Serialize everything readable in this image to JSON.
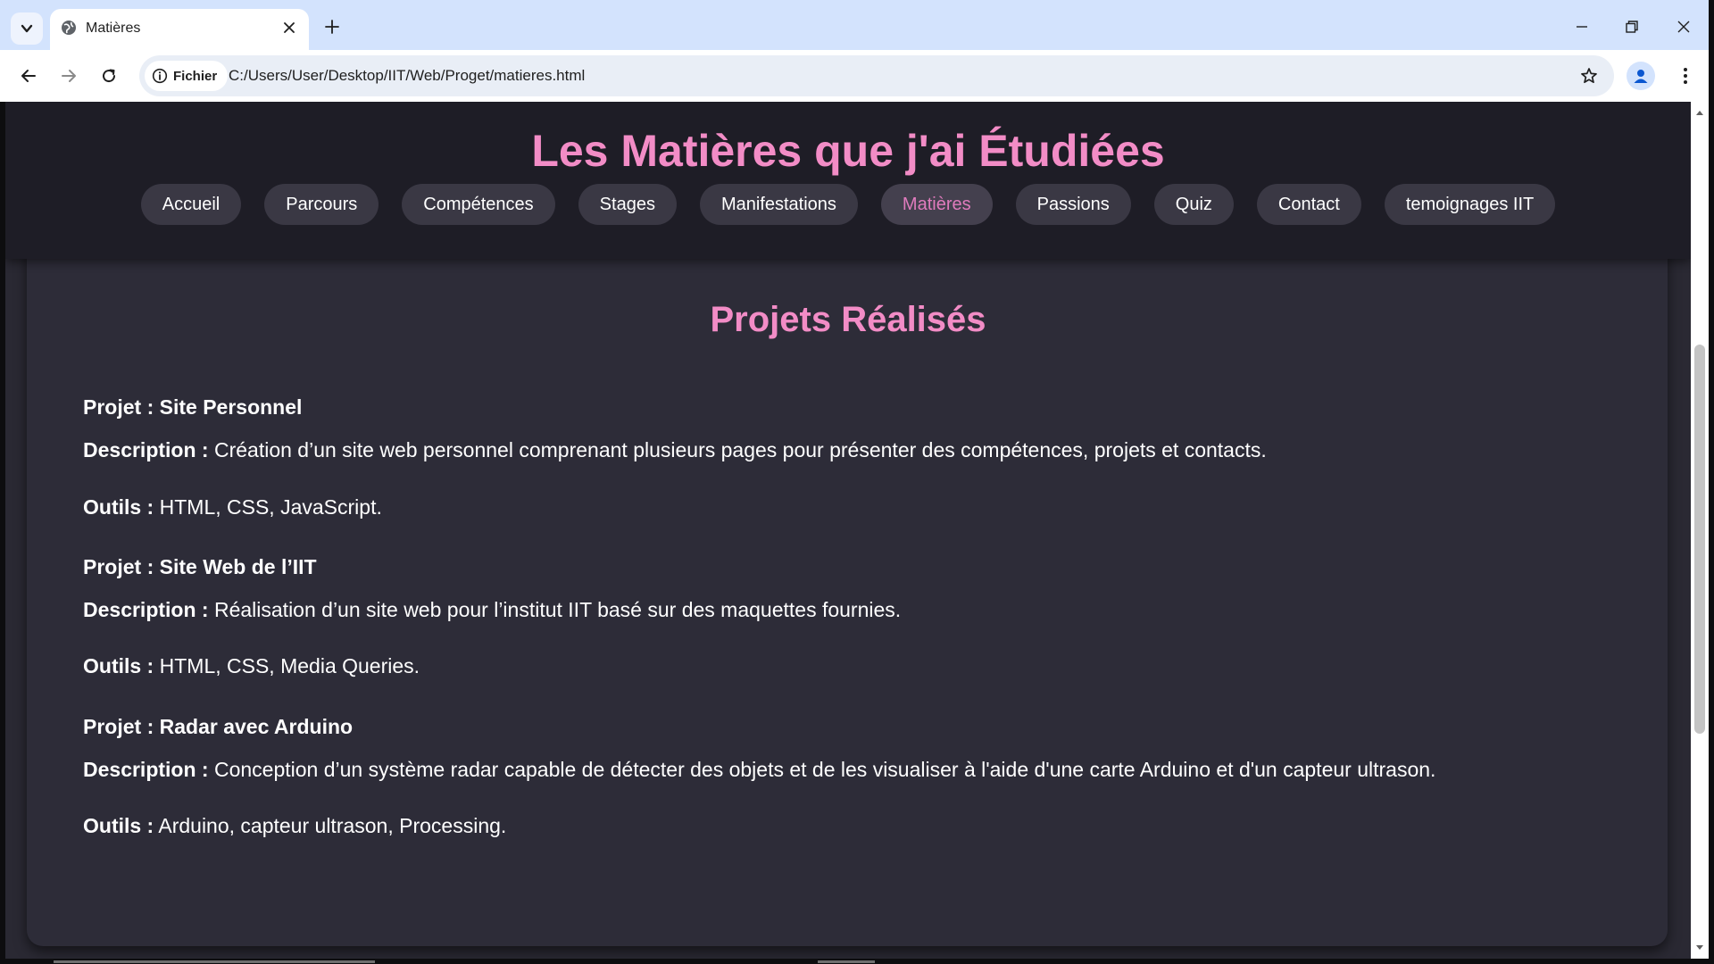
{
  "browser": {
    "tab_title": "Matières",
    "new_tab_glyph": "+",
    "site_info_label": "Fichier",
    "url": "C:/Users/User/Desktop/IIT/Web/Proget/matieres.html",
    "icons": [
      "tab-list-icon",
      "globe-icon",
      "close-icon",
      "plus-icon",
      "minimize-icon",
      "restore-icon",
      "window-close-icon",
      "back-arrow-icon",
      "forward-arrow-icon",
      "reload-icon",
      "info-icon",
      "star-icon",
      "profile-icon",
      "more-vert-icon"
    ]
  },
  "site": {
    "title": "Les Matières que j'ai Étudiées",
    "nav": {
      "accueil": "Accueil",
      "parcours": "Parcours",
      "competences": "Compétences",
      "stages": "Stages",
      "manifestations": "Manifestations",
      "matieres": "Matières",
      "passions": "Passions",
      "quiz": "Quiz",
      "contact": "Contact",
      "temoignages": "temoignages IIT"
    },
    "active_nav": "Matières"
  },
  "projects": {
    "section_title": "Projets Réalisés",
    "description_label": "Description :",
    "tools_label": "Outils :",
    "items": [
      {
        "name": "Projet : Site Personnel",
        "description": "Création d’un site web personnel comprenant plusieurs pages pour présenter des compétences, projets et contacts.",
        "tools": "HTML, CSS, JavaScript."
      },
      {
        "name": "Projet : Site Web de l’IIT",
        "description": "Réalisation d’un site web pour l’institut IIT basé sur des maquettes fournies.",
        "tools": "HTML, CSS, Media Queries."
      },
      {
        "name": "Projet : Radar avec Arduino",
        "description": "Conception d’un système radar capable de détecter des objets et de les visualiser à l'aide d'une carte Arduino et d'un capteur ultrason.",
        "tools": "Arduino, capteur ultrason, Processing."
      }
    ]
  },
  "colors": {
    "accent_pink": "#f28cc6",
    "active_nav_text": "#e07bbd",
    "header_bg": "#1e1d26",
    "card_bg": "#2d2c38",
    "pill_bg": "#3a3844",
    "tabbar_bg": "#d3e3fd"
  }
}
